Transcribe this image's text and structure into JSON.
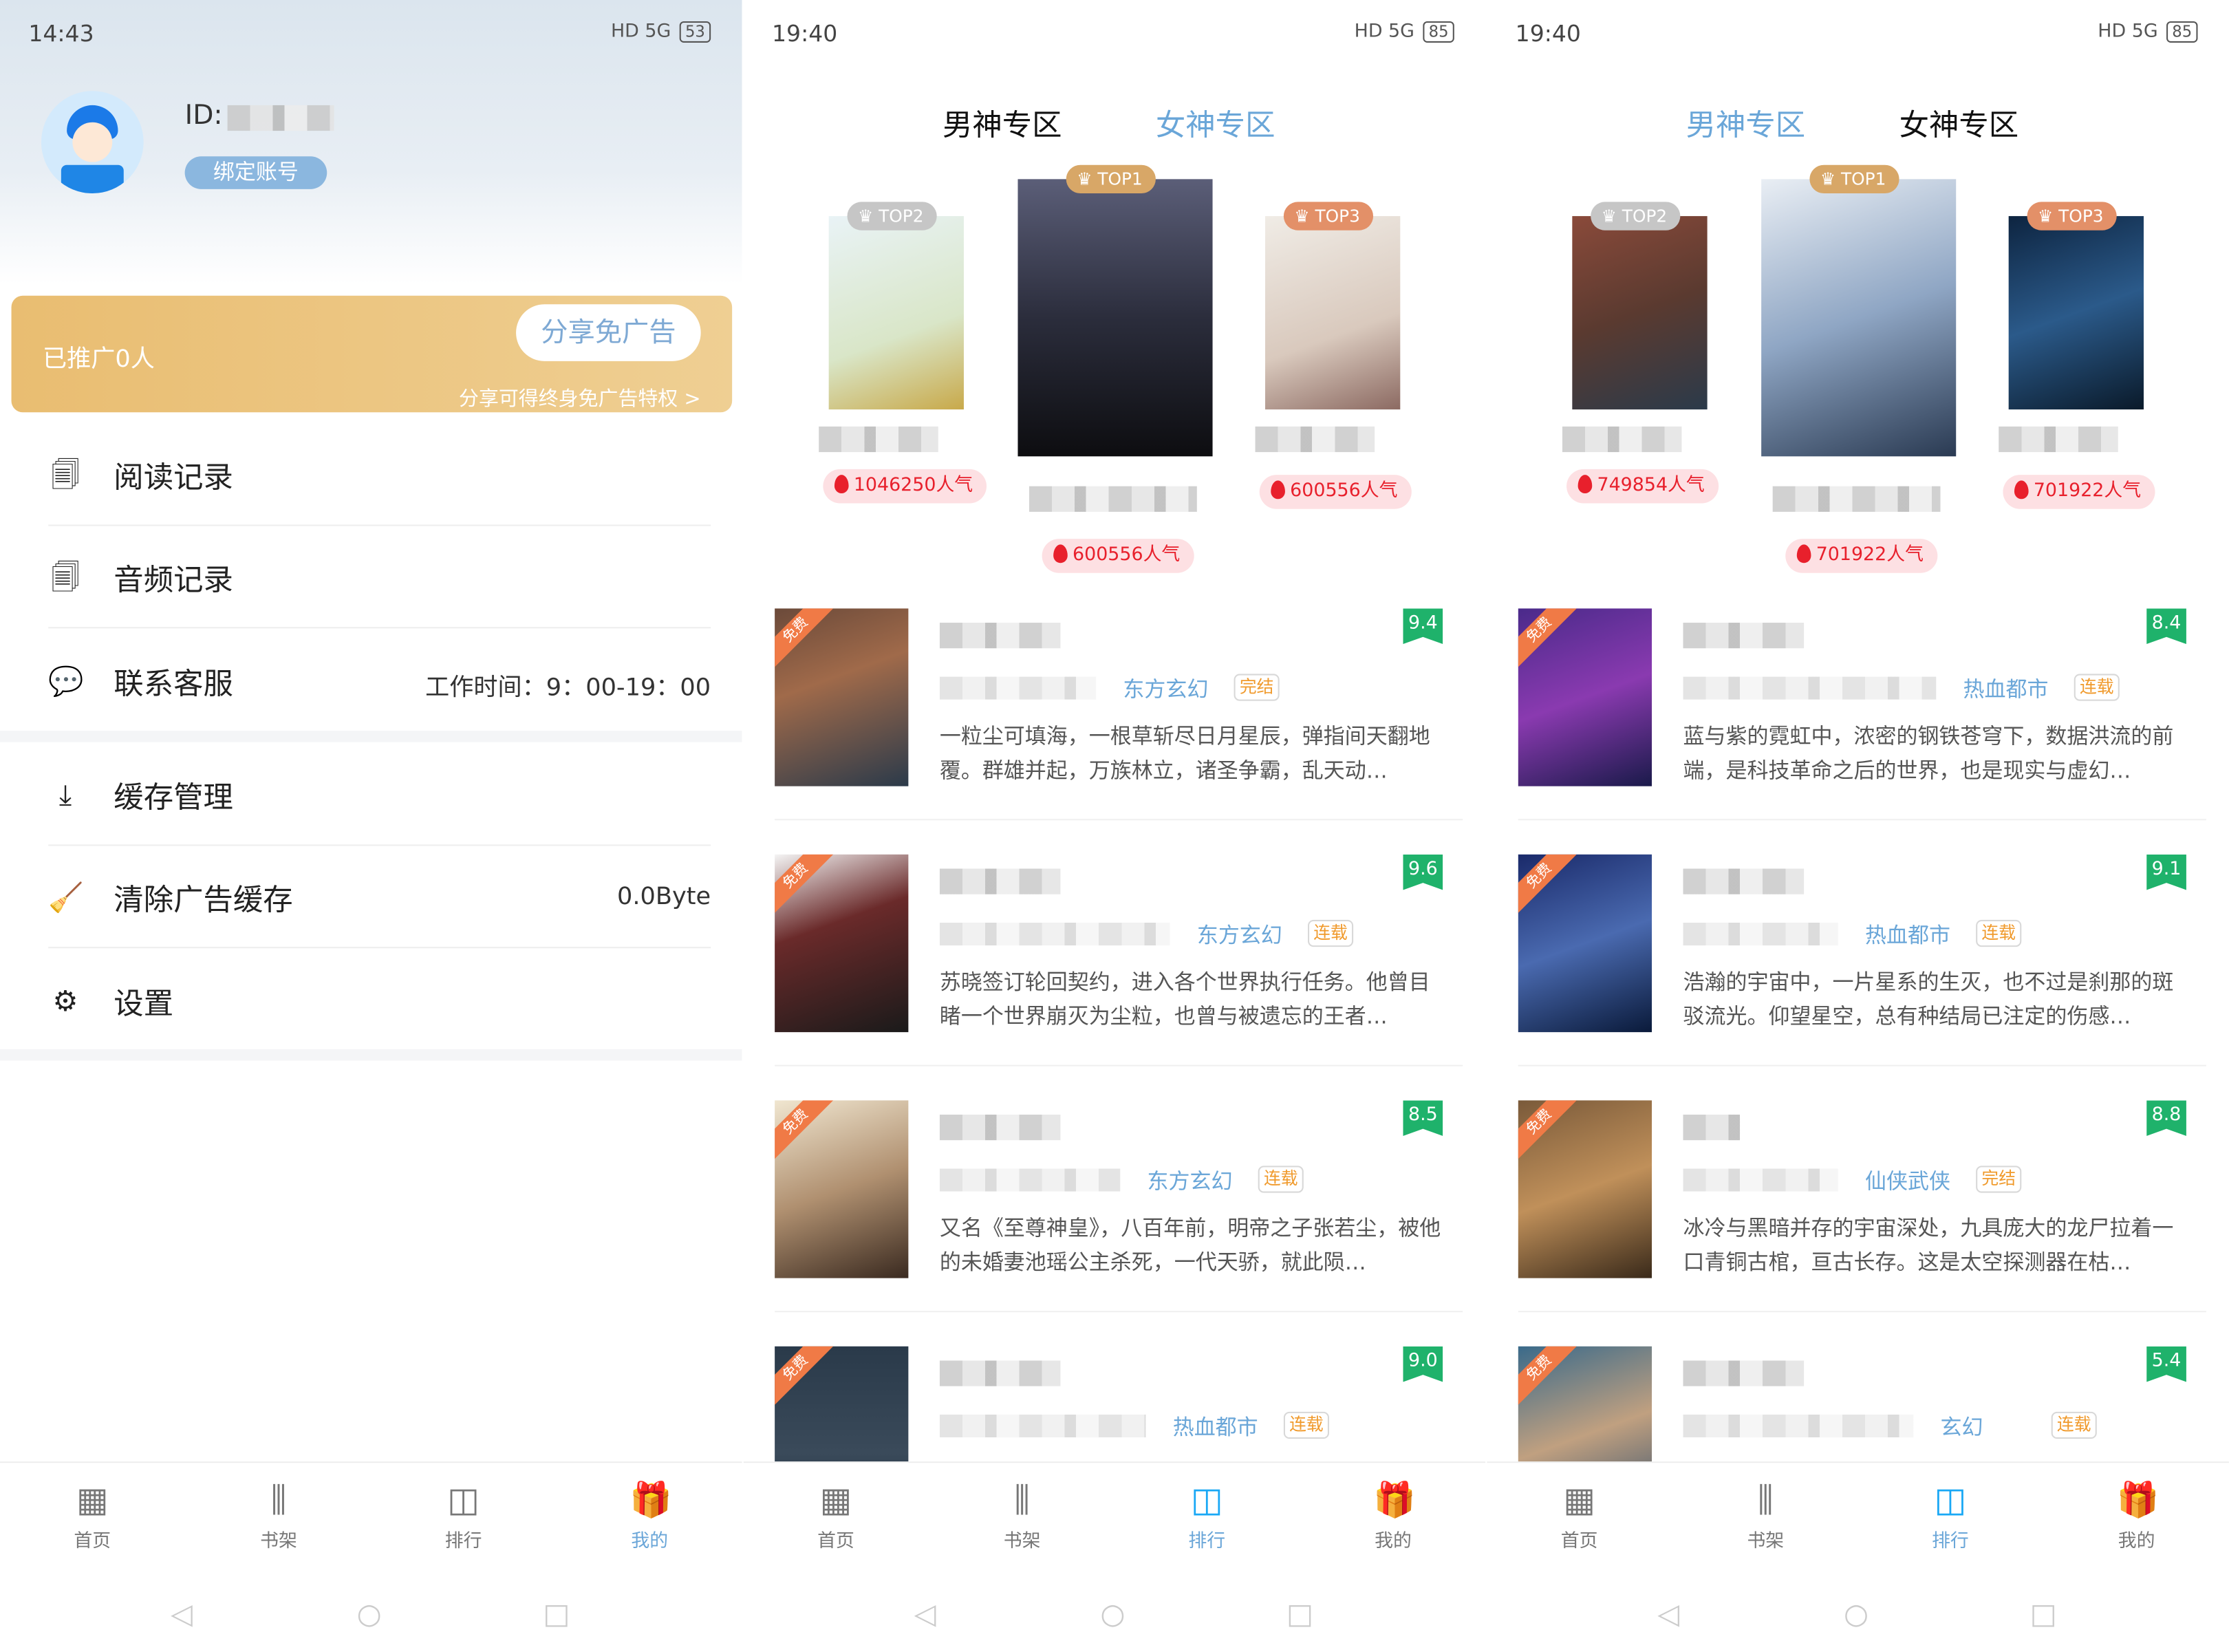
{
  "mine": {
    "status": {
      "time": "14:43",
      "network": "HD 5G",
      "battery": "53"
    },
    "id_label": "ID:",
    "bind_button": "绑定账号",
    "promo": {
      "count": "已推广0人",
      "share_button": "分享免广告",
      "hint": "分享可得终身免广告特权 >"
    },
    "menu": [
      {
        "label": "阅读记录",
        "icon": "reading-history-icon"
      },
      {
        "label": "音频记录",
        "icon": "audio-history-icon"
      },
      {
        "label": "联系客服",
        "icon": "customer-service-icon",
        "value": "工作时间：9：00-19：00"
      },
      {
        "label": "缓存管理",
        "icon": "cache-download-icon"
      },
      {
        "label": "清除广告缓存",
        "icon": "broom-icon",
        "value": "0.0Byte"
      },
      {
        "label": "设置",
        "icon": "gear-icon"
      }
    ],
    "active_nav": 3
  },
  "nav": [
    {
      "label": "首页",
      "icon": "home-grid-icon"
    },
    {
      "label": "书架",
      "icon": "bookshelf-icon"
    },
    {
      "label": "排行",
      "icon": "ranking-bag-icon"
    },
    {
      "label": "我的",
      "icon": "gift-icon"
    }
  ],
  "accent_color": "#1aa8f5",
  "free_badge": "免费",
  "rankings": [
    {
      "status": {
        "time": "19:40",
        "network": "HD 5G",
        "battery": "85"
      },
      "tabs": [
        "男神专区",
        "女神专区"
      ],
      "active_tab": 0,
      "active_nav": 2,
      "top3": [
        {
          "rank": "TOP2",
          "popularity": "1046250人气"
        },
        {
          "rank": "TOP1",
          "popularity": "600556人气"
        },
        {
          "rank": "TOP3",
          "popularity": "600556人气"
        }
      ],
      "books": [
        {
          "score": "9.4",
          "genre": "东方玄幻",
          "status": "完结",
          "desc": "一粒尘可填海，一根草斩尽日月星辰，弹指间天翻地覆。群雄并起，万族林立，诸圣争霸，乱天动…"
        },
        {
          "score": "9.6",
          "genre": "东方玄幻",
          "status": "连载",
          "desc": "苏晓签订轮回契约，进入各个世界执行任务。他曾目睹一个世界崩灭为尘粒，也曾与被遗忘的王者…"
        },
        {
          "score": "8.5",
          "genre": "东方玄幻",
          "status": "连载",
          "desc": "又名《至尊神皇》，八百年前，明帝之子张若尘，被他的未婚妻池瑶公主杀死，一代天骄，就此陨…"
        },
        {
          "score": "9.0",
          "genre": "热血都市",
          "status": "连载",
          "desc": ""
        }
      ]
    },
    {
      "status": {
        "time": "19:40",
        "network": "HD 5G",
        "battery": "85"
      },
      "tabs": [
        "男神专区",
        "女神专区"
      ],
      "active_tab": 1,
      "active_nav": 2,
      "top3": [
        {
          "rank": "TOP2",
          "popularity": "749854人气"
        },
        {
          "rank": "TOP1",
          "popularity": "701922人气"
        },
        {
          "rank": "TOP3",
          "popularity": "701922人气"
        }
      ],
      "books": [
        {
          "score": "8.4",
          "genre": "热血都市",
          "status": "连载",
          "desc": "蓝与紫的霓虹中，浓密的钢铁苍穹下，数据洪流的前端，是科技革命之后的世界，也是现实与虚幻…"
        },
        {
          "score": "9.1",
          "genre": "热血都市",
          "status": "连载",
          "desc": "浩瀚的宇宙中，一片星系的生灭，也不过是刹那的斑驳流光。仰望星空，总有种结局已注定的伤感…"
        },
        {
          "score": "8.8",
          "genre": "仙侠武侠",
          "status": "完结",
          "desc": "冰冷与黑暗并存的宇宙深处，九具庞大的龙尸拉着一口青铜古棺，亘古长存。这是太空探测器在枯…"
        },
        {
          "score": "5.4",
          "genre": "玄幻",
          "status": "连载",
          "desc": ""
        }
      ]
    }
  ]
}
